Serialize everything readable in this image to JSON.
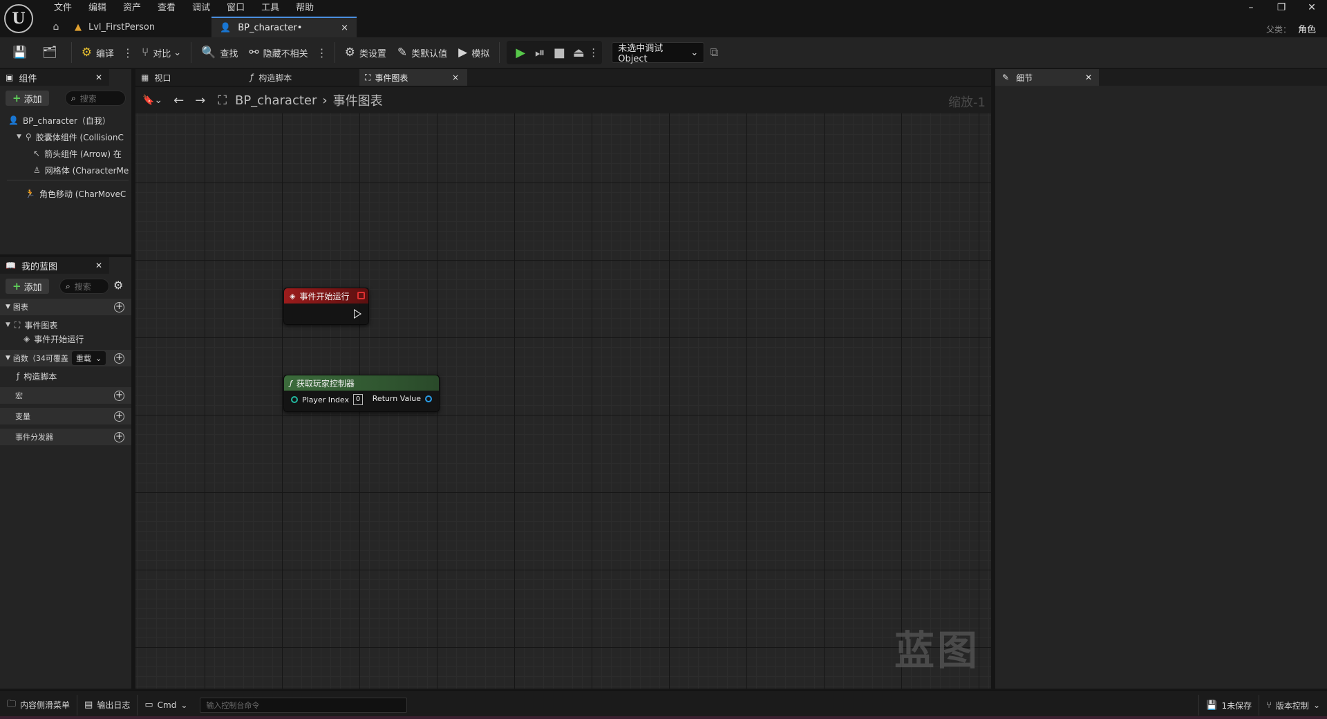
{
  "menu": [
    "文件",
    "编辑",
    "资产",
    "查看",
    "调试",
    "窗口",
    "工具",
    "帮助"
  ],
  "doc_tabs": [
    {
      "label": "Lvl_FirstPerson",
      "icon": "level-icon"
    },
    {
      "label": "BP_character•",
      "icon": "blueprint-icon",
      "close": "×"
    }
  ],
  "window_controls": {
    "minimize": "–",
    "restore": "❐",
    "close": "✕"
  },
  "parent_class": {
    "label": "父类：",
    "value": "角色"
  },
  "toolbar": {
    "compile": "编译",
    "diff": "对比",
    "find": "查找",
    "hide_unrelated": "隐藏不相关",
    "class_settings": "类设置",
    "class_defaults": "类默认值",
    "simulate": "模拟",
    "debug_object": "未选中调试Object"
  },
  "components_panel": {
    "title": "组件",
    "add": "添加",
    "search_placeholder": "搜索",
    "items": [
      {
        "label": "BP_character（自我）",
        "icon": "actor-icon"
      },
      {
        "label": "胶囊体组件 (CollisionC",
        "icon": "capsule-icon"
      },
      {
        "label": "箭头组件 (Arrow)  在",
        "icon": "arrow-icon"
      },
      {
        "label": "网格体 (CharacterMe",
        "icon": "mesh-icon"
      },
      {
        "label": "角色移动 (CharMoveC",
        "icon": "movement-icon"
      }
    ]
  },
  "myblueprint_panel": {
    "title": "我的蓝图",
    "add": "添加",
    "search_placeholder": "搜索",
    "graphs_header": "图表",
    "event_graph": "事件图表",
    "event_begin_play": "事件开始运行",
    "functions_header": "函数（34可覆盖",
    "override": "重载",
    "construction_script": "构造脚本",
    "macros_header": "宏",
    "variables_header": "变量",
    "dispatchers_header": "事件分发器"
  },
  "graph_tabs": [
    {
      "label": "视口",
      "icon": "viewport-icon"
    },
    {
      "label": "构造脚本",
      "icon": "function-icon"
    },
    {
      "label": "事件图表",
      "icon": "graph-icon",
      "close": "×"
    }
  ],
  "breadcrumb": {
    "blueprint": "BP_character",
    "graph": "事件图表"
  },
  "zoom": "缩放-1",
  "watermark": "蓝图",
  "nodes": {
    "begin_play": {
      "title": "事件开始运行"
    },
    "get_player_controller": {
      "title": "获取玩家控制器",
      "input_label": "Player Index",
      "input_value": "0",
      "output_label": "Return Value"
    }
  },
  "details_panel": {
    "title": "细节"
  },
  "statusbar": {
    "content_drawer": "内容侧滑菜单",
    "output_log": "输出日志",
    "cmd": "Cmd",
    "console_placeholder": "输入控制台命令",
    "unsaved": "1未保存",
    "source_control": "版本控制"
  }
}
